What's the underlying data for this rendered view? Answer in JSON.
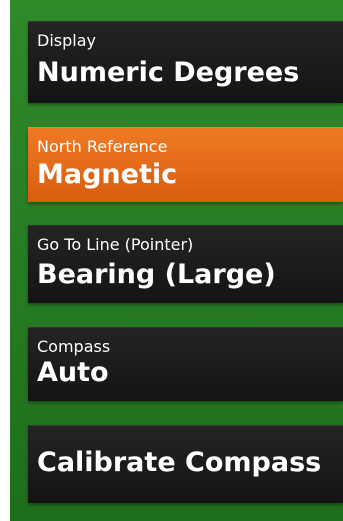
{
  "menu": {
    "items": [
      {
        "label": "Display",
        "value": "Numeric Degrees",
        "selected": false
      },
      {
        "label": "North Reference",
        "value": "Magnetic",
        "selected": true
      },
      {
        "label": "Go To Line (Pointer)",
        "value": "Bearing (Large)",
        "selected": false
      },
      {
        "label": "Compass",
        "value": "Auto",
        "selected": false
      },
      {
        "label": "",
        "value": "Calibrate Compass",
        "selected": false
      }
    ]
  },
  "colors": {
    "background_green": "#2f8a2a",
    "item_background": "#1c1c1c",
    "selected_orange": "#e86f1c",
    "text": "#ffffff"
  }
}
